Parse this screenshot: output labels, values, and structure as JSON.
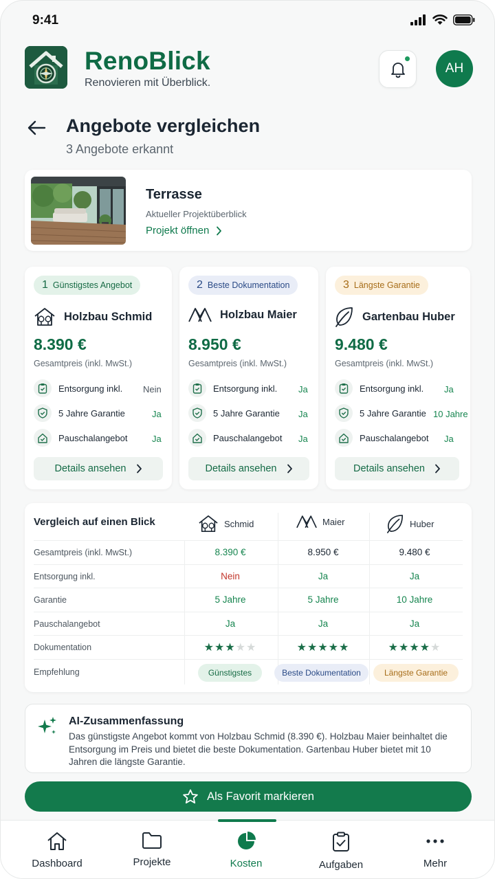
{
  "status_bar": {
    "time": "9:41"
  },
  "header": {
    "app_name": "RenoBlick",
    "tagline": "Renovieren mit Überblick.",
    "avatar_initials": "AH"
  },
  "page": {
    "title": "Angebote vergleichen",
    "subtitle": "3 Angebote erkannt"
  },
  "project": {
    "name": "Terrasse",
    "description": "Aktueller Projektüberblick",
    "link_label": "Projekt öffnen"
  },
  "offers": [
    {
      "rank": "1",
      "badge": "Günstigstes Angebot",
      "vendor": "Holzbau Schmid",
      "price": "8.390 €",
      "price_label": "Gesamtpreis (inkl. MwSt.)",
      "features": [
        {
          "label": "Entsorgung inkl.",
          "value": "Nein"
        },
        {
          "label": "5 Jahre Garantie",
          "value": "Ja"
        },
        {
          "label": "Pauschalangebot",
          "value": "Ja"
        }
      ],
      "details_label": "Details ansehen"
    },
    {
      "rank": "2",
      "badge": "Beste Dokumentation",
      "vendor": "Holzbau Maier",
      "price": "8.950 €",
      "price_label": "Gesamtpreis (inkl. MwSt.)",
      "features": [
        {
          "label": "Entsorgung inkl.",
          "value": "Ja"
        },
        {
          "label": "5 Jahre Garantie",
          "value": "Ja"
        },
        {
          "label": "Pauschalangebot",
          "value": "Ja"
        }
      ],
      "details_label": "Details ansehen"
    },
    {
      "rank": "3",
      "badge": "Längste Garantie",
      "vendor": "Gartenbau Huber",
      "price": "9.480 €",
      "price_label": "Gesamtpreis (inkl. MwSt.)",
      "features": [
        {
          "label": "Entsorgung inkl.",
          "value": "Ja"
        },
        {
          "label": "5 Jahre Garantie",
          "value": "10 Jahre"
        },
        {
          "label": "Pauschalangebot",
          "value": "Ja"
        }
      ],
      "details_label": "Details ansehen"
    }
  ],
  "comparison": {
    "title": "Vergleich auf einen Blick",
    "columns": [
      "Schmid",
      "Maier",
      "Huber"
    ],
    "rows": [
      {
        "label": "Gesamtpreis (inkl. MwSt.)",
        "values": [
          "8.390 €",
          "8.950 €",
          "9.480 €"
        ]
      },
      {
        "label": "Entsorgung inkl.",
        "values": [
          "Nein",
          "Ja",
          "Ja"
        ]
      },
      {
        "label": "Garantie",
        "values": [
          "5 Jahre",
          "5 Jahre",
          "10 Jahre"
        ]
      },
      {
        "label": "Pauschalangebot",
        "values": [
          "Ja",
          "Ja",
          "Ja"
        ]
      },
      {
        "label": "Dokumentation",
        "ratings": [
          3,
          5,
          4
        ],
        "max_rating": 5
      },
      {
        "label": "Empfehlung",
        "values": [
          "Günstigstes",
          "Beste Dokumentation",
          "Längste Garantie"
        ]
      }
    ]
  },
  "ai_summary": {
    "title": "AI-Zusammenfassung",
    "text": "Das günstigste Angebot kommt von Holzbau Schmid (8.390 €). Holzbau Maier beinhaltet die Entsorgung im Preis und bietet die beste Dokumentation. Gartenbau Huber bietet mit 10 Jahren die längste Garantie."
  },
  "favorite_button": {
    "label": "Als Favorit markieren"
  },
  "bottom_nav": {
    "items": [
      "Dashboard",
      "Projekte",
      "Kosten",
      "Aufgaben",
      "Mehr"
    ],
    "active": "Kosten"
  },
  "colors": {
    "brand": "#0f6b45",
    "accent": "#137a4c",
    "positive": "#16854f",
    "negative": "#c2362b",
    "badge_green": "#e3f2e9",
    "badge_blue": "#e9edf7",
    "badge_orange": "#fcf0dc"
  }
}
